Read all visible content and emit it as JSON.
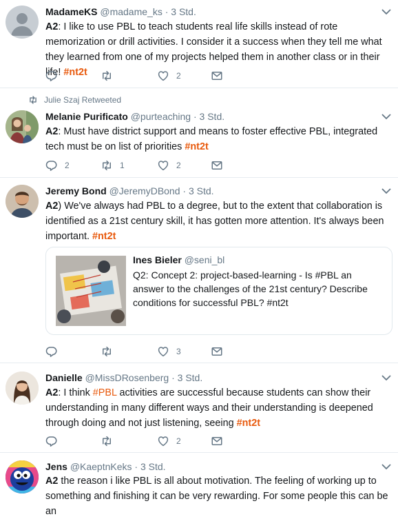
{
  "tweets": [
    {
      "name": "MadameKS",
      "handle": "@madame_ks",
      "sep": " · ",
      "time": "3 Std.",
      "prefix": "A2",
      "body": ": I like to use PBL to teach students real life skills instead of rote memorization or drill activities. I consider it a success when they tell me what they learned from one of my projects helped them in another class or in their life! ",
      "hashtag": "#nt2t",
      "replies": "",
      "retweets": "",
      "likes": "2"
    },
    {
      "retweeted_by": "Julie Szaj Retweeted",
      "name": "Melanie Purificato",
      "handle": "@purteaching",
      "sep": " · ",
      "time": "3 Std.",
      "prefix": "A2",
      "body": ": Must have district support and means to foster effective PBL, integrated tech must be on list of priorities ",
      "hashtag": "#nt2t",
      "replies": "2",
      "retweets": "1",
      "likes": "2"
    },
    {
      "name": "Jeremy Bond",
      "handle": "@JeremyDBond",
      "sep": " · ",
      "time": "3 Std.",
      "prefix": "A2",
      "body": ") We've always had PBL to a degree, but to the extent that collaboration is identified as a 21st century skill, it has gotten more attention. It's always been important. ",
      "hashtag": "#nt2t",
      "quote": {
        "name": "Ines Bieler",
        "handle": "@seni_bl",
        "text": "Q2: Concept 2: project-based-learning - Is #PBL an answer to the challenges of the 21st century? Describe conditions for successful PBL? #nt2t"
      },
      "replies": "",
      "retweets": "",
      "likes": "3"
    },
    {
      "name": "Danielle",
      "handle": "@MissDRosenberg",
      "sep": " · ",
      "time": "3 Std.",
      "prefix": "A2",
      "body_a": ": I think ",
      "inline_tag": "#PBL",
      "body_b": " activities are successful because students can show their understanding in many different ways and their understanding is deepened through doing and not just listening, seeing  ",
      "hashtag": "#nt2t",
      "replies": "",
      "retweets": "",
      "likes": "2"
    },
    {
      "name": "Jens",
      "handle": "@KaeptnKeks",
      "sep": " · ",
      "time": "3 Std.",
      "prefix": "A2",
      "body": " the reason i like PBL is all about motivation. The feeling of working up to something and finishing it can be very rewarding. For some people this can be an"
    }
  ],
  "colors": {
    "hashtag": "#e8590c",
    "meta": "#657786",
    "divider": "#e6ecf0",
    "rt_green": "#17bf63"
  },
  "icons": [
    "reply-icon",
    "retweet-icon",
    "like-icon",
    "message-icon",
    "caret-down-icon"
  ]
}
